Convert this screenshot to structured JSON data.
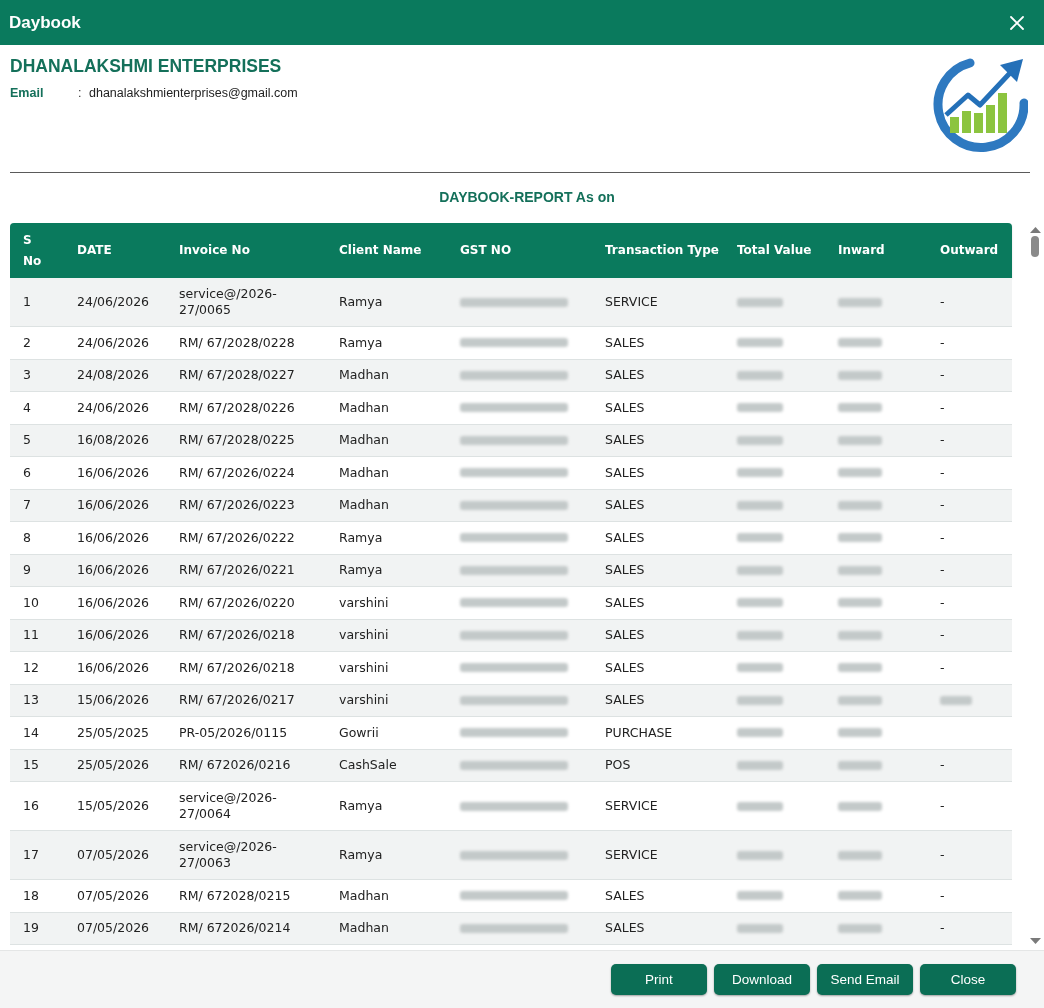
{
  "window": {
    "title": "Daybook"
  },
  "company": {
    "name": "DHANALAKSHMI ENTERPRISES",
    "email_label": "Email",
    "email_separator": ":",
    "email": "dhanalakshmienterprises@gmail.com"
  },
  "report_title": "DAYBOOK-REPORT As on",
  "table": {
    "columns": [
      "S No",
      "DATE",
      "Invoice No",
      "Client Name",
      "GST NO",
      "Transaction Type",
      "Total Value",
      "Inward",
      "Outward"
    ],
    "rows": [
      {
        "s_no": "1",
        "date": "24/06/2026",
        "invoice_no": "service@/2026-27/0065",
        "client_name": "Ramya",
        "gst_no": {
          "kind": "blurred"
        },
        "transaction_type": "SERVICE",
        "total_value": {
          "kind": "blurred"
        },
        "inward": {
          "kind": "blurred"
        },
        "outward": {
          "kind": "text",
          "text": "-"
        }
      },
      {
        "s_no": "2",
        "date": "24/06/2026",
        "invoice_no": "RM/ 67/2028/0228",
        "client_name": "Ramya",
        "gst_no": {
          "kind": "blurred"
        },
        "transaction_type": "SALES",
        "total_value": {
          "kind": "blurred"
        },
        "inward": {
          "kind": "blurred"
        },
        "outward": {
          "kind": "text",
          "text": "-"
        }
      },
      {
        "s_no": "3",
        "date": "24/08/2026",
        "invoice_no": "RM/ 67/2028/0227",
        "client_name": "Madhan",
        "gst_no": {
          "kind": "blurred"
        },
        "transaction_type": "SALES",
        "total_value": {
          "kind": "blurred"
        },
        "inward": {
          "kind": "blurred"
        },
        "outward": {
          "kind": "text",
          "text": "-"
        }
      },
      {
        "s_no": "4",
        "date": "24/06/2026",
        "invoice_no": "RM/ 67/2028/0226",
        "client_name": "Madhan",
        "gst_no": {
          "kind": "blurred"
        },
        "transaction_type": "SALES",
        "total_value": {
          "kind": "blurred"
        },
        "inward": {
          "kind": "blurred"
        },
        "outward": {
          "kind": "text",
          "text": "-"
        }
      },
      {
        "s_no": "5",
        "date": "16/08/2026",
        "invoice_no": "RM/ 67/2028/0225",
        "client_name": "Madhan",
        "gst_no": {
          "kind": "blurred"
        },
        "transaction_type": "SALES",
        "total_value": {
          "kind": "blurred"
        },
        "inward": {
          "kind": "blurred"
        },
        "outward": {
          "kind": "text",
          "text": "-"
        }
      },
      {
        "s_no": "6",
        "date": "16/06/2026",
        "invoice_no": "RM/ 67/2026/0224",
        "client_name": "Madhan",
        "gst_no": {
          "kind": "blurred"
        },
        "transaction_type": "SALES",
        "total_value": {
          "kind": "blurred"
        },
        "inward": {
          "kind": "blurred"
        },
        "outward": {
          "kind": "text",
          "text": "-"
        }
      },
      {
        "s_no": "7",
        "date": "16/06/2026",
        "invoice_no": "RM/ 67/2026/0223",
        "client_name": "Madhan",
        "gst_no": {
          "kind": "blurred"
        },
        "transaction_type": "SALES",
        "total_value": {
          "kind": "blurred"
        },
        "inward": {
          "kind": "blurred"
        },
        "outward": {
          "kind": "text",
          "text": "-"
        }
      },
      {
        "s_no": "8",
        "date": "16/06/2026",
        "invoice_no": "RM/ 67/2026/0222",
        "client_name": "Ramya",
        "gst_no": {
          "kind": "blurred"
        },
        "transaction_type": "SALES",
        "total_value": {
          "kind": "blurred"
        },
        "inward": {
          "kind": "blurred"
        },
        "outward": {
          "kind": "text",
          "text": "-"
        }
      },
      {
        "s_no": "9",
        "date": "16/06/2026",
        "invoice_no": "RM/ 67/2026/0221",
        "client_name": "Ramya",
        "gst_no": {
          "kind": "blurred"
        },
        "transaction_type": "SALES",
        "total_value": {
          "kind": "blurred"
        },
        "inward": {
          "kind": "blurred"
        },
        "outward": {
          "kind": "text",
          "text": "-"
        }
      },
      {
        "s_no": "10",
        "date": "16/06/2026",
        "invoice_no": "RM/ 67/2026/0220",
        "client_name": "varshini",
        "gst_no": {
          "kind": "blurred"
        },
        "transaction_type": "SALES",
        "total_value": {
          "kind": "blurred"
        },
        "inward": {
          "kind": "blurred"
        },
        "outward": {
          "kind": "text",
          "text": "-"
        }
      },
      {
        "s_no": "11",
        "date": "16/06/2026",
        "invoice_no": "RM/ 67/2026/0218",
        "client_name": "varshini",
        "gst_no": {
          "kind": "blurred"
        },
        "transaction_type": "SALES",
        "total_value": {
          "kind": "blurred"
        },
        "inward": {
          "kind": "blurred"
        },
        "outward": {
          "kind": "text",
          "text": "-"
        }
      },
      {
        "s_no": "12",
        "date": "16/06/2026",
        "invoice_no": "RM/ 67/2026/0218",
        "client_name": "varshini",
        "gst_no": {
          "kind": "blurred"
        },
        "transaction_type": "SALES",
        "total_value": {
          "kind": "blurred"
        },
        "inward": {
          "kind": "blurred"
        },
        "outward": {
          "kind": "text",
          "text": "-"
        }
      },
      {
        "s_no": "13",
        "date": "15/06/2026",
        "invoice_no": "RM/ 67/2026/0217",
        "client_name": "varshini",
        "gst_no": {
          "kind": "blurred"
        },
        "transaction_type": "SALES",
        "total_value": {
          "kind": "blurred"
        },
        "inward": {
          "kind": "blurred"
        },
        "outward": {
          "kind": "blurred"
        }
      },
      {
        "s_no": "14",
        "date": "25/05/2025",
        "invoice_no": "PR-05/2026/0115",
        "client_name": "Gowrii",
        "gst_no": {
          "kind": "blurred"
        },
        "transaction_type": "PURCHASE",
        "total_value": {
          "kind": "blurred"
        },
        "inward": {
          "kind": "blurred"
        }
      },
      {
        "s_no": "15",
        "date": "25/05/2026",
        "invoice_no": "RM/ 672026/0216",
        "client_name": "CashSale",
        "gst_no": {
          "kind": "blurred"
        },
        "transaction_type": "POS",
        "total_value": {
          "kind": "blurred"
        },
        "inward": {
          "kind": "blurred"
        },
        "outward": {
          "kind": "text",
          "text": "-"
        }
      },
      {
        "s_no": "16",
        "date": "15/05/2026",
        "invoice_no": "service@/2026-27/0064",
        "client_name": "Ramya",
        "gst_no": {
          "kind": "blurred"
        },
        "transaction_type": "SERVICE",
        "total_value": {
          "kind": "blurred"
        },
        "inward": {
          "kind": "blurred"
        },
        "outward": {
          "kind": "text",
          "text": "-"
        }
      },
      {
        "s_no": "17",
        "date": "07/05/2026",
        "invoice_no": "service@/2026-27/0063",
        "client_name": "Ramya",
        "gst_no": {
          "kind": "blurred"
        },
        "transaction_type": "SERVICE",
        "total_value": {
          "kind": "blurred"
        },
        "inward": {
          "kind": "blurred"
        },
        "outward": {
          "kind": "text",
          "text": "-"
        }
      },
      {
        "s_no": "18",
        "date": "07/05/2026",
        "invoice_no": "RM/ 672028/0215",
        "client_name": "Madhan",
        "gst_no": {
          "kind": "blurred"
        },
        "transaction_type": "SALES",
        "total_value": {
          "kind": "blurred"
        },
        "inward": {
          "kind": "blurred"
        },
        "outward": {
          "kind": "text",
          "text": "-"
        }
      },
      {
        "s_no": "19",
        "date": "07/05/2026",
        "invoice_no": "RM/ 672026/0214",
        "client_name": "Madhan",
        "gst_no": {
          "kind": "blurred"
        },
        "transaction_type": "SALES",
        "total_value": {
          "kind": "blurred"
        },
        "inward": {
          "kind": "blurred"
        },
        "outward": {
          "kind": "text",
          "text": "-"
        }
      }
    ]
  },
  "buttons": [
    "Print",
    "Download",
    "Send Email",
    "Close"
  ]
}
